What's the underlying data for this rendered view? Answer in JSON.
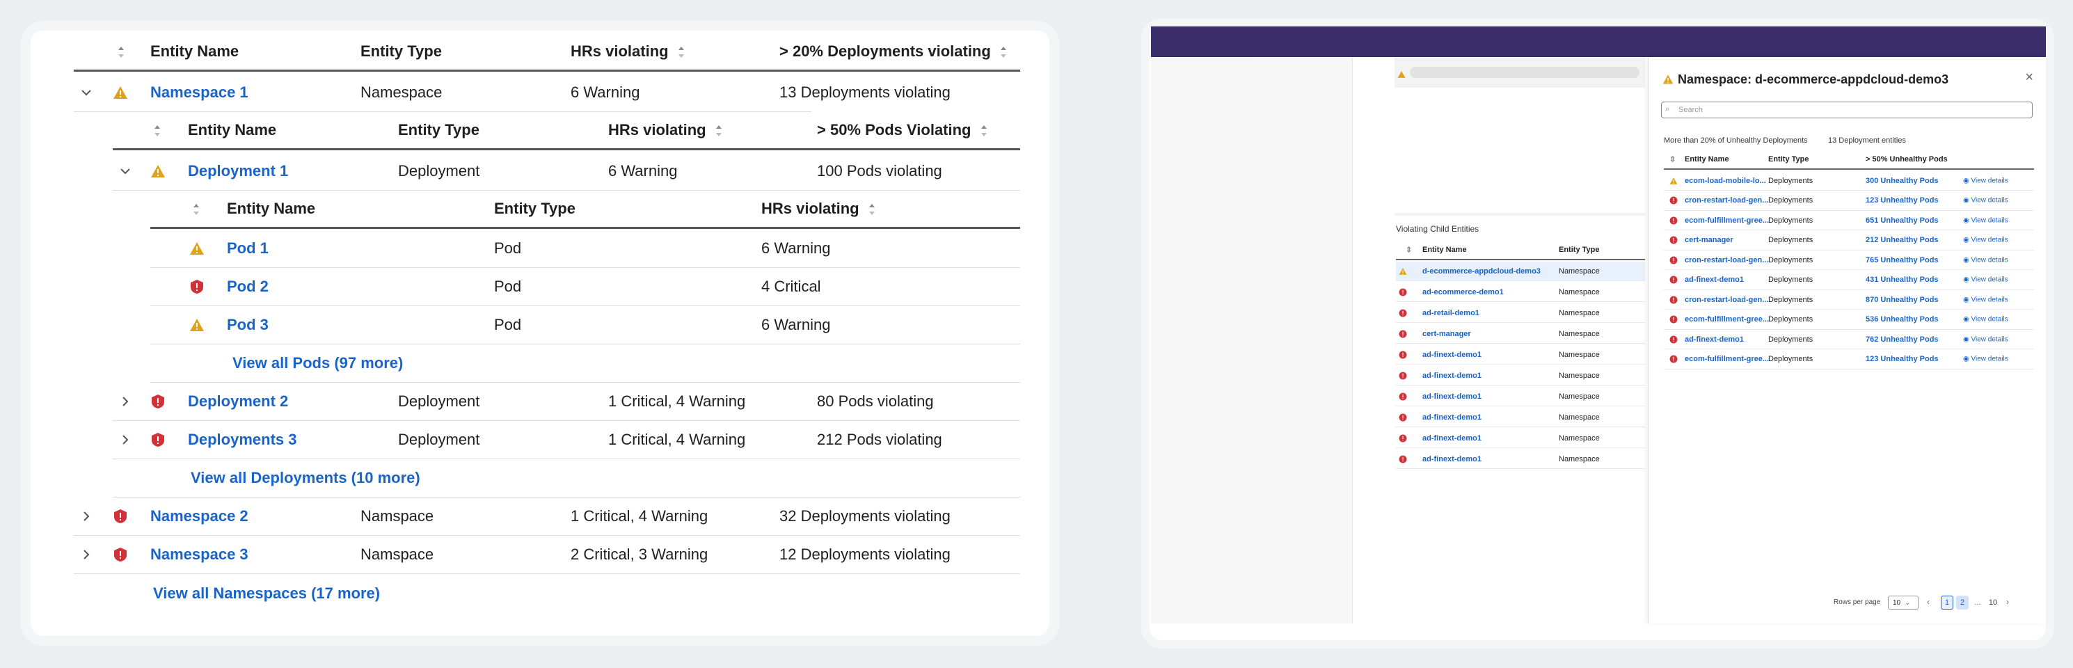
{
  "left_table": {
    "headers": {
      "entity_name": "Entity Name",
      "entity_type": "Entity Type",
      "hrs_violating": "HRs violating",
      "deployments_violating": "> 20% Deployments violating"
    },
    "namespace1": {
      "name": "Namespace 1",
      "type": "Namespace",
      "hrs": "6 Warning",
      "violating": "13 Deployments violating"
    },
    "deploy_headers": {
      "entity_name": "Entity Name",
      "entity_type": "Entity Type",
      "hrs_violating": "HRs violating",
      "pods_violating": "> 50% Pods Violating"
    },
    "deployment1": {
      "name": "Deployment 1",
      "type": "Deployment",
      "hrs": "6 Warning",
      "violating": "100 Pods violating"
    },
    "pod_headers": {
      "entity_name": "Entity Name",
      "entity_type": "Entity Type",
      "hrs_violating": "HRs violating"
    },
    "pods": [
      {
        "name": "Pod 1",
        "type": "Pod",
        "hrs": "6 Warning",
        "status": "warning"
      },
      {
        "name": "Pod 2",
        "type": "Pod",
        "hrs": "4 Critical",
        "status": "critical"
      },
      {
        "name": "Pod 3",
        "type": "Pod",
        "hrs": "6 Warning",
        "status": "warning"
      }
    ],
    "view_all_pods": "View all Pods (97 more)",
    "deployment2": {
      "name": "Deployment 2",
      "type": "Deployment",
      "hrs": "1 Critical, 4 Warning",
      "violating": "80 Pods violating"
    },
    "deployment3": {
      "name": "Deployments 3",
      "type": "Deployment",
      "hrs": "1 Critical, 4 Warning",
      "violating": "212 Pods violating"
    },
    "view_all_deployments": "View all Deployments (10 more)",
    "namespace2": {
      "name": "Namespace 2",
      "type": "Namspace",
      "hrs": "1 Critical, 4 Warning",
      "violating": "32 Deployments violating"
    },
    "namespace3": {
      "name": "Namespace 3",
      "type": "Namspace",
      "hrs": "2 Critical, 3 Warning",
      "violating": "12 Deployments violating"
    },
    "view_all_namespaces": "View all Namespaces (17 more)"
  },
  "colors": {
    "warning": "#e0a21b",
    "critical": "#d1323a",
    "link": "#1a64c8",
    "topbar": "#3c2e6b"
  },
  "background_panel": {
    "title": "Violating Child Entities",
    "headers": {
      "entity_name": "Entity Name",
      "entity_type": "Entity Type"
    },
    "rows": [
      {
        "name": "d-ecommerce-appdcloud-demo3",
        "type": "Namespace",
        "status": "warning"
      },
      {
        "name": "ad-ecommerce-demo1",
        "type": "Namespace",
        "status": "critical"
      },
      {
        "name": "ad-retail-demo1",
        "type": "Namespace",
        "status": "critical"
      },
      {
        "name": "cert-manager",
        "type": "Namespace",
        "status": "critical"
      },
      {
        "name": "ad-finext-demo1",
        "type": "Namespace",
        "status": "critical"
      },
      {
        "name": "ad-finext-demo1",
        "type": "Namespace",
        "status": "critical"
      },
      {
        "name": "ad-finext-demo1",
        "type": "Namespace",
        "status": "critical"
      },
      {
        "name": "ad-finext-demo1",
        "type": "Namespace",
        "status": "critical"
      },
      {
        "name": "ad-finext-demo1",
        "type": "Namespace",
        "status": "critical"
      },
      {
        "name": "ad-finext-demo1",
        "type": "Namespace",
        "status": "critical"
      }
    ]
  },
  "drawer": {
    "title": "Namespace: d-ecommerce-appdcloud-demo3",
    "close": "×",
    "search_placeholder": "Search",
    "summary_left": "More than 20% of Unhealthy Deployments",
    "summary_right": "13 Deployment entities",
    "headers": {
      "entity_name": "Entity Name",
      "entity_type": "Entity Type",
      "pods": "> 50% Unhealthy Pods"
    },
    "view_details": "View details",
    "rows": [
      {
        "name": "ecom-load-mobile-lo...",
        "type": "Deployments",
        "pods": "300 Unhealthy Pods",
        "status": "warning"
      },
      {
        "name": "cron-restart-load-gen...",
        "type": "Deployments",
        "pods": "123 Unhealthy Pods",
        "status": "critical"
      },
      {
        "name": "ecom-fulfillment-gree...",
        "type": "Deployments",
        "pods": "651 Unhealthy Pods",
        "status": "critical"
      },
      {
        "name": "cert-manager",
        "type": "Deployments",
        "pods": "212 Unhealthy Pods",
        "status": "critical"
      },
      {
        "name": "cron-restart-load-gen...",
        "type": "Deployments",
        "pods": "765 Unhealthy Pods",
        "status": "critical"
      },
      {
        "name": "ad-finext-demo1",
        "type": "Deployments",
        "pods": "431 Unhealthy Pods",
        "status": "critical"
      },
      {
        "name": "cron-restart-load-gen...",
        "type": "Deployments",
        "pods": "870 Unhealthy Pods",
        "status": "critical"
      },
      {
        "name": "ecom-fulfillment-gree...",
        "type": "Deployments",
        "pods": "536 Unhealthy Pods",
        "status": "critical"
      },
      {
        "name": "ad-finext-demo1",
        "type": "Deployments",
        "pods": "762 Unhealthy Pods",
        "status": "critical"
      },
      {
        "name": "ecom-fulfillment-gree...",
        "type": "Deployments",
        "pods": "123 Unhealthy Pods",
        "status": "critical"
      }
    ],
    "pagination": {
      "rows_per_page_label": "Rows per page",
      "rows_per_page": "10",
      "pages": [
        "1",
        "2",
        "...",
        "10"
      ],
      "current": "1"
    }
  }
}
